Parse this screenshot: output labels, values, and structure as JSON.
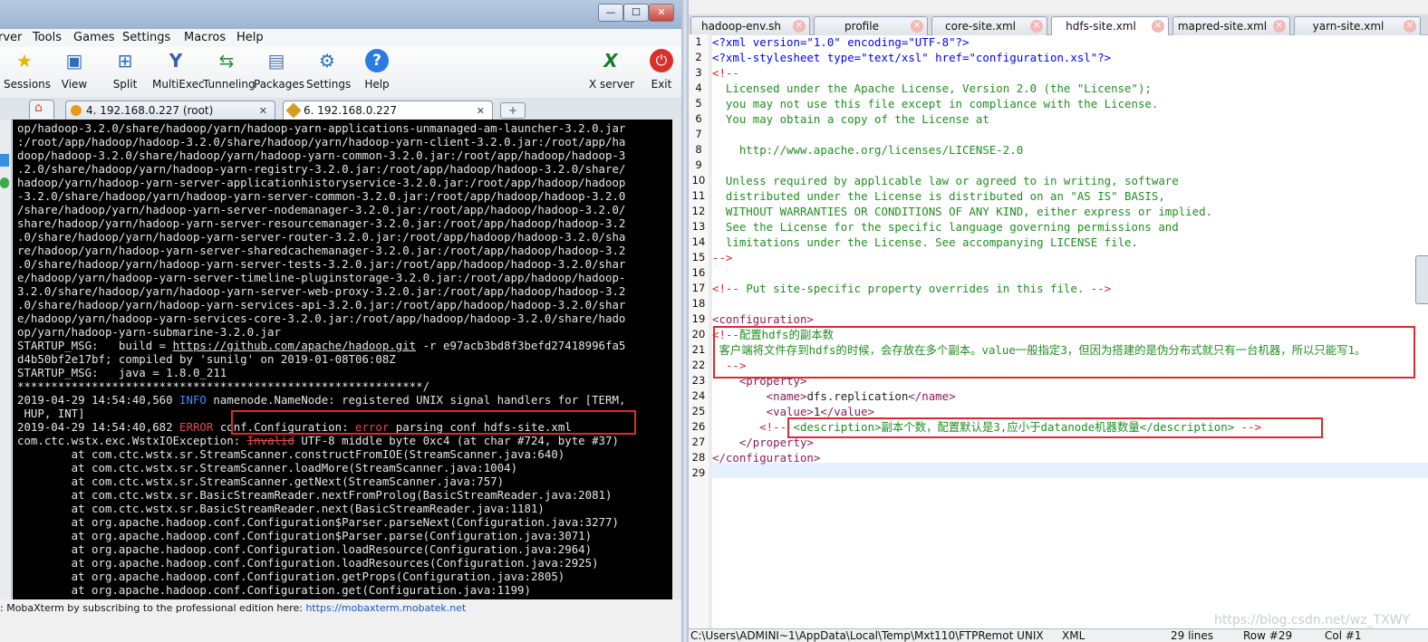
{
  "left_window": {
    "menu": [
      "rver",
      "Tools",
      "Games",
      "Settings",
      "Macros",
      "Help"
    ],
    "toolbar": [
      {
        "label": "Sessions",
        "icon": "star-icon",
        "glyph": "★",
        "color": "#e8b400"
      },
      {
        "label": "View",
        "icon": "monitor-icon",
        "glyph": "▣",
        "color": "#2f6fb8"
      },
      {
        "label": "Split",
        "icon": "split-icon",
        "glyph": "⊞",
        "color": "#2f6fb8"
      },
      {
        "label": "MultiExec",
        "icon": "fork-icon",
        "glyph": "Y",
        "color": "#3a5fb0"
      },
      {
        "label": "Tunneling",
        "icon": "tunnel-icon",
        "glyph": "⇆",
        "color": "#2f8f3a"
      },
      {
        "label": "Packages",
        "icon": "package-icon",
        "glyph": "▤",
        "color": "#5577aa"
      },
      {
        "label": "Settings",
        "icon": "gear-icon",
        "glyph": "⚙",
        "color": "#2f6fb8"
      },
      {
        "label": "Help",
        "icon": "help-icon",
        "glyph": "?",
        "color": "#ffffff"
      },
      {
        "label": "X server",
        "icon": "xserver-icon",
        "glyph": "X",
        "color": "#1a7a2a"
      },
      {
        "label": "Exit",
        "icon": "power-icon",
        "glyph": "⏻",
        "color": "#ffffff"
      }
    ],
    "tabs": [
      {
        "label": "4. 192.168.0.227 (root)",
        "close": "✕"
      },
      {
        "label": "6. 192.168.0.227",
        "close": "✕"
      }
    ],
    "terminal_lines": [
      [
        {
          "t": "op/hadoop-3.2.0/share/hadoop/yarn/hadoop-yarn-applications-unmanaged-am-launcher-3.2.0.jar"
        }
      ],
      [
        {
          "t": ":/root/app/hadoop/hadoop-3.2.0/share/hadoop/yarn/hadoop-yarn-client-3.2.0.jar:/root/app/ha"
        }
      ],
      [
        {
          "t": "doop/hadoop-3.2.0/share/hadoop/yarn/hadoop-yarn-common-3.2.0.jar:/root/app/hadoop/hadoop-3"
        }
      ],
      [
        {
          "t": ".2.0/share/hadoop/yarn/hadoop-yarn-registry-3.2.0.jar:/root/app/hadoop/hadoop-3.2.0/share/"
        }
      ],
      [
        {
          "t": "hadoop/yarn/hadoop-yarn-server-applicationhistoryservice-3.2.0.jar:/root/app/hadoop/hadoop"
        }
      ],
      [
        {
          "t": "-3.2.0/share/hadoop/yarn/hadoop-yarn-server-common-3.2.0.jar:/root/app/hadoop/hadoop-3.2.0"
        }
      ],
      [
        {
          "t": "/share/hadoop/yarn/hadoop-yarn-server-nodemanager-3.2.0.jar:/root/app/hadoop/hadoop-3.2.0/"
        }
      ],
      [
        {
          "t": "share/hadoop/yarn/hadoop-yarn-server-resourcemanager-3.2.0.jar:/root/app/hadoop/hadoop-3.2"
        }
      ],
      [
        {
          "t": ".0/share/hadoop/yarn/hadoop-yarn-server-router-3.2.0.jar:/root/app/hadoop/hadoop-3.2.0/sha"
        }
      ],
      [
        {
          "t": "re/hadoop/yarn/hadoop-yarn-server-sharedcachemanager-3.2.0.jar:/root/app/hadoop/hadoop-3.2"
        }
      ],
      [
        {
          "t": ".0/share/hadoop/yarn/hadoop-yarn-server-tests-3.2.0.jar:/root/app/hadoop/hadoop-3.2.0/shar"
        }
      ],
      [
        {
          "t": "e/hadoop/yarn/hadoop-yarn-server-timeline-pluginstorage-3.2.0.jar:/root/app/hadoop/hadoop-"
        }
      ],
      [
        {
          "t": "3.2.0/share/hadoop/yarn/hadoop-yarn-server-web-proxy-3.2.0.jar:/root/app/hadoop/hadoop-3.2"
        }
      ],
      [
        {
          "t": ".0/share/hadoop/yarn/hadoop-yarn-services-api-3.2.0.jar:/root/app/hadoop/hadoop-3.2.0/shar"
        }
      ],
      [
        {
          "t": "e/hadoop/yarn/hadoop-yarn-services-core-3.2.0.jar:/root/app/hadoop/hadoop-3.2.0/share/hado"
        }
      ],
      [
        {
          "t": "op/yarn/hadoop-yarn-submarine-3.2.0.jar"
        }
      ],
      [
        {
          "t": "STARTUP_MSG:   build = "
        },
        {
          "t": "https://github.com/apache/hadoop.git",
          "c": "link-u"
        },
        {
          "t": " -r e97acb3bd8f3befd27418996fa5"
        }
      ],
      [
        {
          "t": "d4b50bf2e17bf; compiled by 'sunilg' on 2019-01-08T06:08Z"
        }
      ],
      [
        {
          "t": "STARTUP_MSG:   java = 1.8.0_211"
        }
      ],
      [
        {
          "t": "************************************************************/"
        }
      ],
      [
        {
          "t": "2019-04-29 14:54:40,560 "
        },
        {
          "t": "INFO",
          "c": "info"
        },
        {
          "t": " namenode.NameNode: registered UNIX signal handlers for [TERM,"
        }
      ],
      [
        {
          "t": " HUP, INT]"
        }
      ],
      [
        {
          "t": "2019-04-29 14:54:40,682 "
        },
        {
          "t": "ERROR",
          "c": "err"
        },
        {
          "t": " conf.Configuration: "
        },
        {
          "t": "error",
          "c": "err"
        },
        {
          "t": " parsing conf hdfs-site.xml"
        }
      ],
      [
        {
          "t": "com.ctc.wstx.exc.WstxIOException: "
        },
        {
          "t": "Invalid",
          "c": "strike"
        },
        {
          "t": " UTF-8 middle byte 0xc4 (at char #724, byte #37)"
        }
      ],
      [
        {
          "t": "        at com.ctc.wstx.sr.StreamScanner.constructFromIOE(StreamScanner.java:640)"
        }
      ],
      [
        {
          "t": "        at com.ctc.wstx.sr.StreamScanner.loadMore(StreamScanner.java:1004)"
        }
      ],
      [
        {
          "t": "        at com.ctc.wstx.sr.StreamScanner.getNext(StreamScanner.java:757)"
        }
      ],
      [
        {
          "t": "        at com.ctc.wstx.sr.BasicStreamReader.nextFromProlog(BasicStreamReader.java:2081)"
        }
      ],
      [
        {
          "t": "        at com.ctc.wstx.sr.BasicStreamReader.next(BasicStreamReader.java:1181)"
        }
      ],
      [
        {
          "t": "        at org.apache.hadoop.conf.Configuration$Parser.parseNext(Configuration.java:3277)"
        }
      ],
      [
        {
          "t": "        at org.apache.hadoop.conf.Configuration$Parser.parse(Configuration.java:3071)"
        }
      ],
      [
        {
          "t": "        at org.apache.hadoop.conf.Configuration.loadResource(Configuration.java:2964)"
        }
      ],
      [
        {
          "t": "        at org.apache.hadoop.conf.Configuration.loadResources(Configuration.java:2925)"
        }
      ],
      [
        {
          "t": "        at org.apache.hadoop.conf.Configuration.getProps(Configuration.java:2805)"
        }
      ],
      [
        {
          "t": "        at org.apache.hadoop.conf.Configuration.get(Configuration.java:1199)"
        }
      ]
    ],
    "status_prefix": ": MobaXterm by subscribing to the professional edition here:  ",
    "status_link": "https://mobaxterm.mobatek.net"
  },
  "editor": {
    "tabs": [
      {
        "label": "hadoop-env.sh",
        "active": false
      },
      {
        "label": "profile",
        "active": false
      },
      {
        "label": "core-site.xml",
        "active": false
      },
      {
        "label": "hdfs-site.xml",
        "active": true
      },
      {
        "label": "mapred-site.xml",
        "active": false
      },
      {
        "label": "yarn-site.xml",
        "active": false
      }
    ],
    "close_glyph": "✕",
    "lines": [
      [
        {
          "t": "<?xml version=\"1.0\" encoding=\"UTF-8\"?>",
          "c": "pi"
        }
      ],
      [
        {
          "t": "<?xml-stylesheet type=\"text/xsl\" href=\"configuration.xsl\"?>",
          "c": "pi"
        }
      ],
      [
        {
          "t": "<!--",
          "c": "cmd"
        }
      ],
      [
        {
          "t": "  Licensed under the Apache License, Version 2.0 (the \"License\");",
          "c": "cm"
        }
      ],
      [
        {
          "t": "  you may not use this file except in compliance with the License.",
          "c": "cm"
        }
      ],
      [
        {
          "t": "  You may obtain a copy of the License at",
          "c": "cm"
        }
      ],
      [
        {
          "t": "",
          "c": "cm"
        }
      ],
      [
        {
          "t": "    http://www.apache.org/licenses/LICENSE-2.0",
          "c": "cm"
        }
      ],
      [
        {
          "t": "",
          "c": "cm"
        }
      ],
      [
        {
          "t": "  Unless required by applicable law or agreed to in writing, software",
          "c": "cm"
        }
      ],
      [
        {
          "t": "  distributed under the License is distributed on an \"AS IS\" BASIS,",
          "c": "cm"
        }
      ],
      [
        {
          "t": "  WITHOUT WARRANTIES OR CONDITIONS OF ANY KIND, either express or implied.",
          "c": "cm"
        }
      ],
      [
        {
          "t": "  See the License for the specific language governing permissions and",
          "c": "cm"
        }
      ],
      [
        {
          "t": "  limitations under the License. See accompanying LICENSE file.",
          "c": "cm"
        }
      ],
      [
        {
          "t": "-->",
          "c": "cmd"
        }
      ],
      [
        {
          "t": ""
        }
      ],
      [
        {
          "t": "<!-- ",
          "c": "cmd"
        },
        {
          "t": "Put site-specific property overrides in this file.",
          "c": "cm"
        },
        {
          "t": " -->",
          "c": "cmd"
        }
      ],
      [
        {
          "t": ""
        }
      ],
      [
        {
          "t": "<configuration>",
          "c": "tag"
        }
      ],
      [
        {
          "t": "<!--",
          "c": "cmd"
        },
        {
          "t": "配置hdfs的副本数",
          "c": "cm"
        }
      ],
      [
        {
          "t": " 客户端将文件存到hdfs的时候，会存放在多个副本。value一般指定3，但因为搭建的是伪分布式就只有一台机器，所以只能写1。",
          "c": "cm"
        }
      ],
      [
        {
          "t": "  -->",
          "c": "cmd"
        }
      ],
      [
        {
          "t": "    <property>",
          "c": "tag"
        }
      ],
      [
        {
          "t": "        <name>",
          "c": "tag"
        },
        {
          "t": "dfs.replication",
          "c": "txt"
        },
        {
          "t": "</name>",
          "c": "tag"
        }
      ],
      [
        {
          "t": "        <value>",
          "c": "tag"
        },
        {
          "t": "1",
          "c": "txt"
        },
        {
          "t": "</value>",
          "c": "tag"
        }
      ],
      [
        {
          "t": "       <!-- ",
          "c": "cmd"
        },
        {
          "t": "<description>副本个数，配置默认是3,应小于datanode机器数量</description>",
          "c": "cm"
        },
        {
          "t": " -->",
          "c": "cmd"
        }
      ],
      [
        {
          "t": "    </property>",
          "c": "tag"
        }
      ],
      [
        {
          "t": "</configuration>",
          "c": "tag"
        }
      ],
      [
        {
          "t": ""
        }
      ]
    ],
    "status": {
      "path": "C:\\Users\\ADMINI~1\\AppData\\Local\\Temp\\Mxt110\\FTPRemot UNIX",
      "type": "XML",
      "lines": "29 lines",
      "row": "Row #29",
      "col": "Col #1"
    }
  },
  "watermark": "https://blog.csdn.net/wz_TXWY"
}
